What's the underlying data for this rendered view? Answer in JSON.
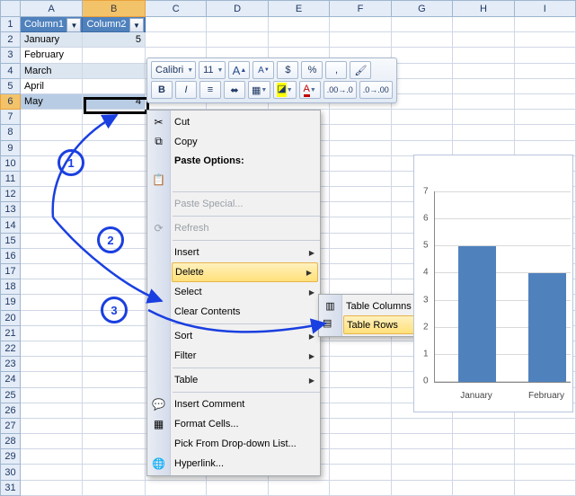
{
  "columns": [
    "A",
    "B",
    "C",
    "D",
    "E",
    "F",
    "G",
    "H",
    "I"
  ],
  "rows": [
    1,
    2,
    3,
    4,
    5,
    6,
    7,
    8,
    9,
    10,
    11,
    12,
    13,
    14,
    15,
    16,
    17,
    18,
    19,
    20,
    21,
    22,
    23,
    24,
    25,
    26,
    27,
    28,
    29,
    30,
    31
  ],
  "table": {
    "headers": [
      "Column1",
      "Column2"
    ],
    "rows": [
      {
        "a": "January",
        "b": "5"
      },
      {
        "a": "February",
        "b": ""
      },
      {
        "a": "March",
        "b": ""
      },
      {
        "a": "April",
        "b": ""
      },
      {
        "a": "May",
        "b": "4"
      }
    ]
  },
  "activeCell": {
    "col": "B",
    "row": 6
  },
  "minibar": {
    "font": "Calibri",
    "size": "11",
    "grow": "A",
    "shrink": "A",
    "styleIcon": "⎌",
    "pct": "%",
    "comma": ",",
    "paint": "✎",
    "bold": "B",
    "italic": "I",
    "align1": "≡",
    "align2": "≡",
    "border": "▭",
    "fill": "◪",
    "fontcolor": "A",
    "dec1": "⁰⁰",
    "dec2": "⁰"
  },
  "contextMenu": {
    "cut": "Cut",
    "copy": "Copy",
    "pasteOptionsHeader": "Paste Options:",
    "pasteSpecial": "Paste Special...",
    "refresh": "Refresh",
    "insert": "Insert",
    "delete": "Delete",
    "select": "Select",
    "clear": "Clear Contents",
    "sort": "Sort",
    "filter": "Filter",
    "tableItem": "Table",
    "insertComment": "Insert Comment",
    "formatCells": "Format Cells...",
    "pickList": "Pick From Drop-down List...",
    "hyperlink": "Hyperlink..."
  },
  "submenu": {
    "tableColumns": "Table Columns",
    "tableRows": "Table Rows"
  },
  "annotations": {
    "one": "1",
    "two": "2",
    "three": "3"
  },
  "chart_data": {
    "type": "bar",
    "categories": [
      "January",
      "February"
    ],
    "values": [
      5,
      4
    ],
    "ylim": [
      0,
      7
    ],
    "yticks": [
      0,
      1,
      2,
      3,
      4,
      5,
      6,
      7
    ],
    "title": "",
    "xlabel": "",
    "ylabel": ""
  }
}
